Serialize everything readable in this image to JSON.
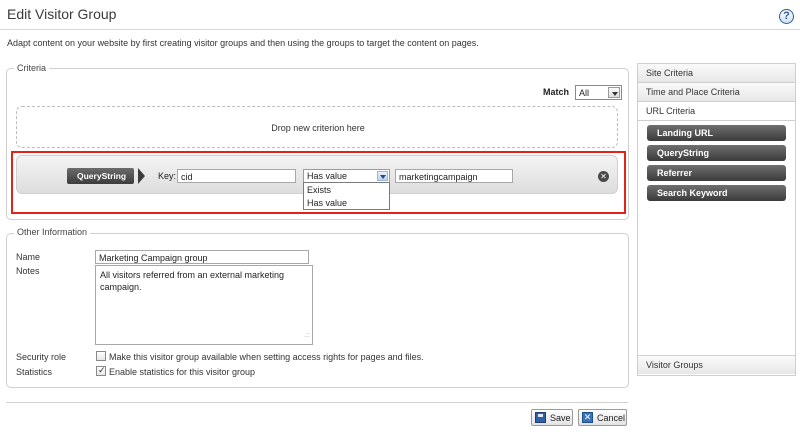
{
  "header": {
    "title": "Edit Visitor Group",
    "help_glyph": "?",
    "intro": "Adapt content on your website by first creating visitor groups and then using the groups to target the content on pages."
  },
  "criteria": {
    "legend": "Criteria",
    "match_label": "Match",
    "match_value": "All",
    "drop_text": "Drop new criterion here",
    "criterion": {
      "tag": "QueryString",
      "key_label": "Key:",
      "key_value": "cid",
      "operator_value": "Has value",
      "operator_options": [
        "Exists",
        "Has value"
      ],
      "value": "marketingcampaign",
      "remove_glyph": "✕"
    }
  },
  "other_info": {
    "legend": "Other Information",
    "name_label": "Name",
    "name_value": "Marketing Campaign group",
    "notes_label": "Notes",
    "notes_value": "All visitors referred from an external marketing campaign.",
    "security_label": "Security role",
    "security_checkbox_label": "Make this visitor group available when setting access rights for pages and files.",
    "security_checked": false,
    "statistics_label": "Statistics",
    "statistics_checkbox_label": "Enable statistics for this visitor group",
    "statistics_checked": true
  },
  "actions": {
    "save_label": "Save",
    "cancel_label": "Cancel",
    "cancel_glyph": "✕"
  },
  "right_panel": {
    "sections": [
      "Site Criteria",
      "Time and Place Criteria",
      "URL Criteria"
    ],
    "url_criteria_items": [
      "Landing URL",
      "QueryString",
      "Referrer",
      "Search Keyword"
    ],
    "footer_section": "Visitor Groups"
  },
  "colors": {
    "highlight_border": "#e2231a",
    "dark_button": "#3c3c3c",
    "help_icon": "#2b5d9b"
  }
}
